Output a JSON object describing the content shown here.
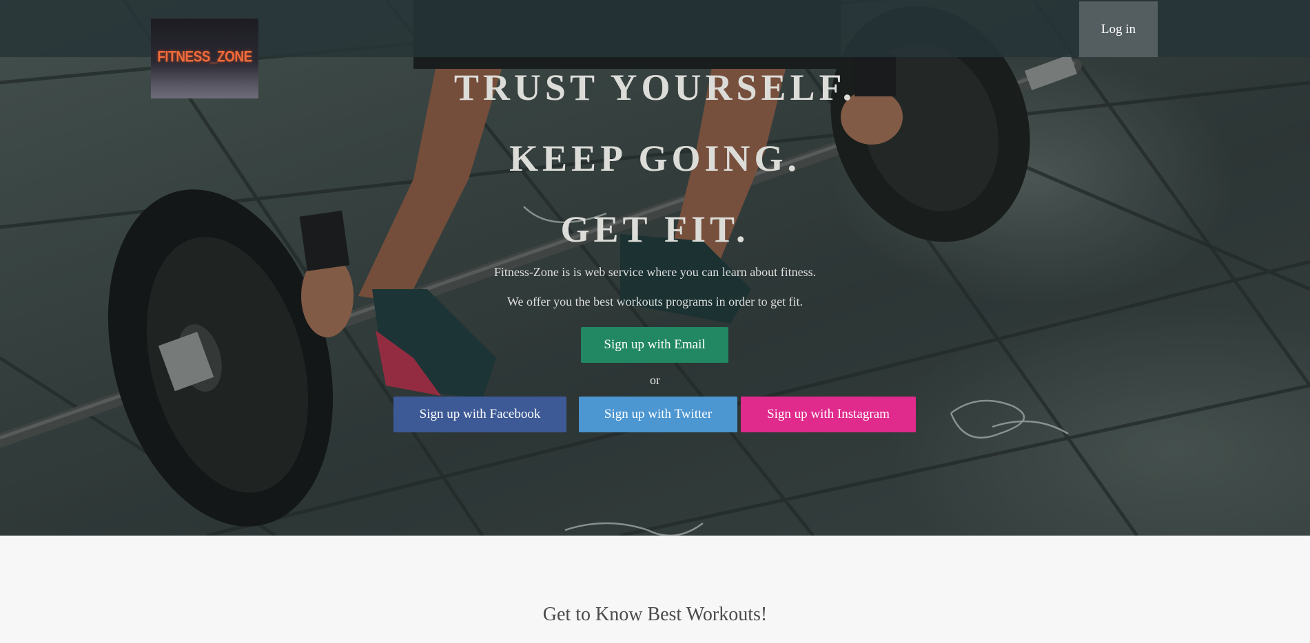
{
  "nav": {
    "logo_text": "FITNESS_ZONE",
    "login_label": "Log in"
  },
  "hero": {
    "headline_1": "TRUST YOURSELF.",
    "headline_2": "KEEP GOING.",
    "headline_3": "GET FIT.",
    "description_1": "Fitness-Zone is is web service where you can learn about fitness.",
    "description_2": "We offer you the best workouts programs in order to get fit.",
    "email_button": "Sign up with Email",
    "or_text": "or",
    "facebook_button": "Sign up with Facebook",
    "twitter_button": "Sign up with Twitter",
    "instagram_button": "Sign up with Instagram"
  },
  "section": {
    "title": "Get to Know Best Workouts!"
  },
  "colors": {
    "email": "#228863",
    "facebook": "#3d5a96",
    "twitter": "#4c96d1",
    "instagram": "#e02a8c",
    "logo_text": "#f26b3a"
  },
  "icons": {
    "hero_image": "barbell-deadlift-photo"
  }
}
